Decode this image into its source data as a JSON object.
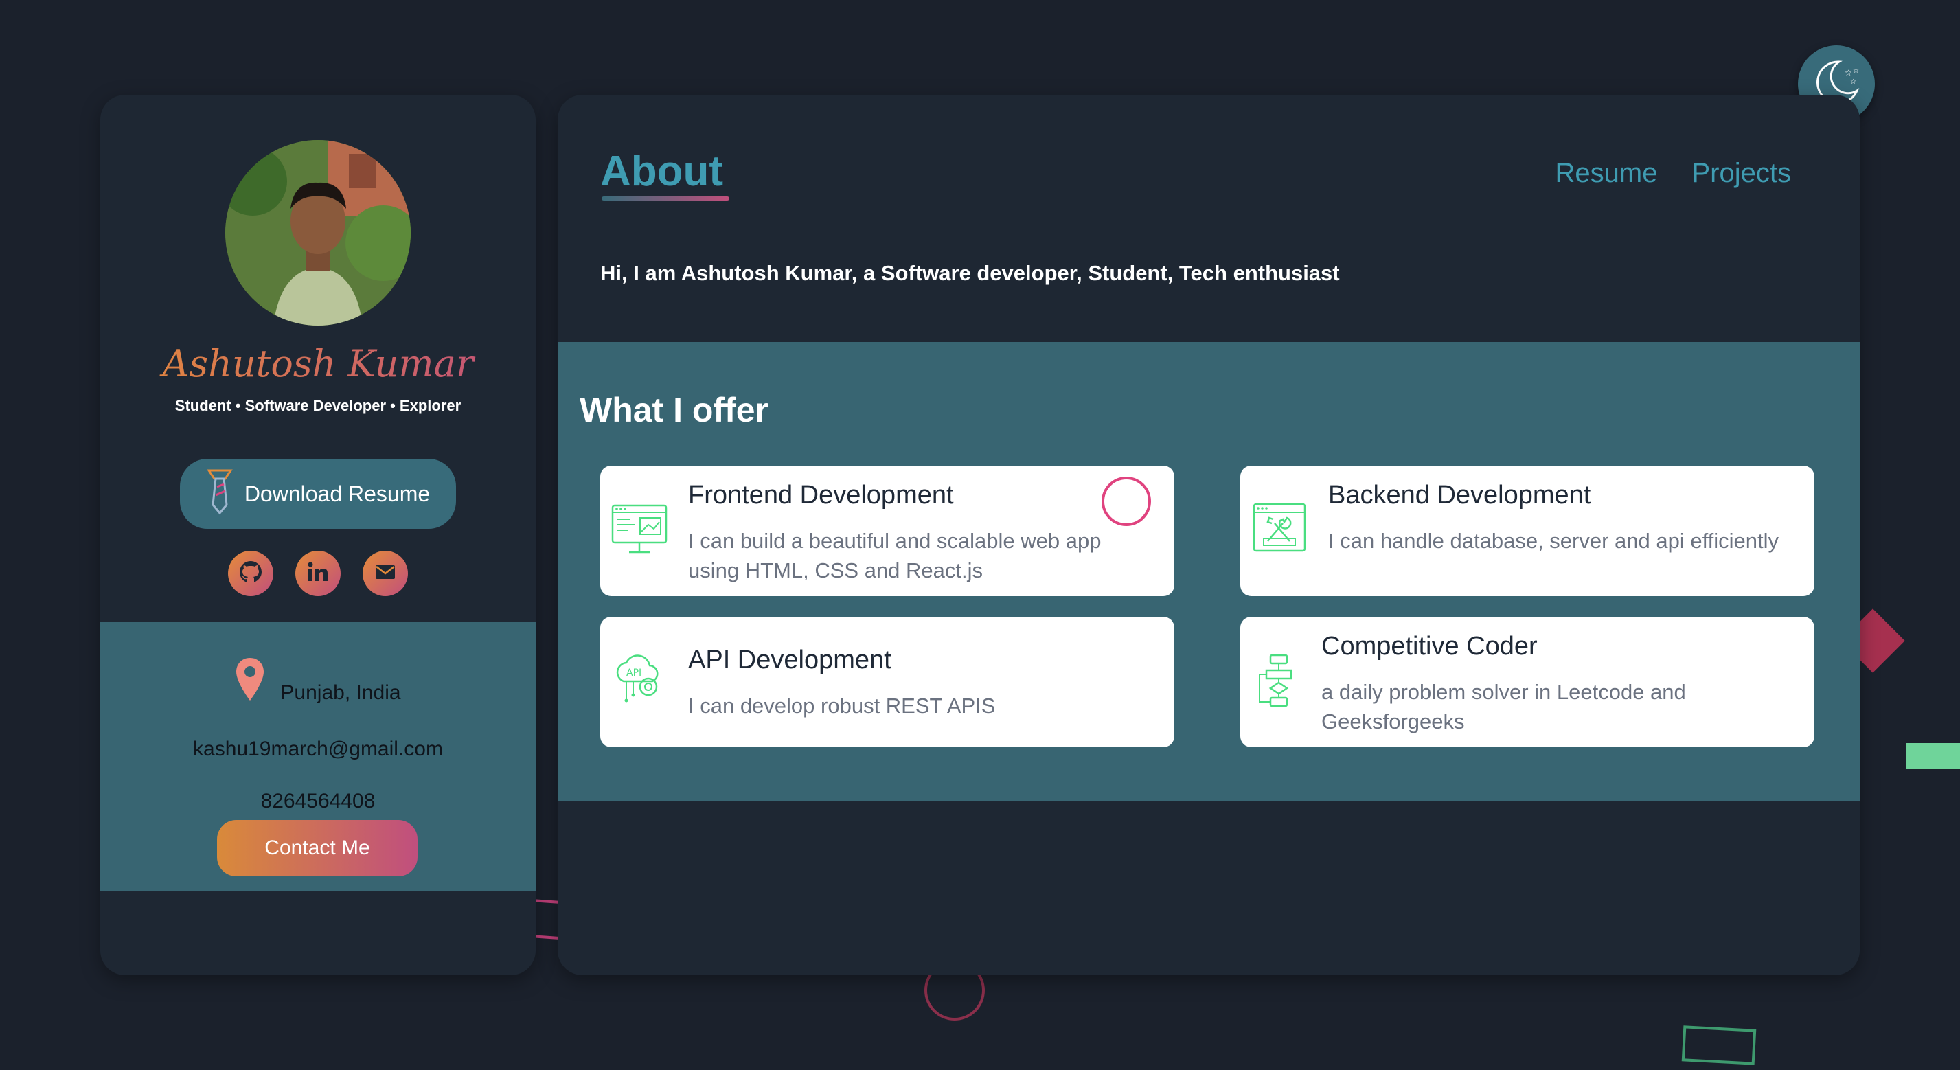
{
  "theme_toggle": {
    "icon": "moon-stars-icon"
  },
  "profile": {
    "name": "Ashutosh Kumar",
    "tagline": "Student • Software Developer • Explorer",
    "download_label": "Download Resume",
    "socials": [
      {
        "icon": "github-icon"
      },
      {
        "icon": "linkedin-icon"
      },
      {
        "icon": "mail-icon"
      }
    ],
    "location": "Punjab, India",
    "email": "kashu19march@gmail.com",
    "phone": "8264564408",
    "contact_label": "Contact Me"
  },
  "main": {
    "title": "About",
    "nav": [
      {
        "label": "Resume"
      },
      {
        "label": "Projects"
      }
    ],
    "intro": "Hi, I am Ashutosh Kumar, a Software developer, Student, Tech enthusiast",
    "offer_title": "What I offer",
    "services": [
      {
        "title": "Frontend Development",
        "description": "I can build a beautiful and scalable web app using HTML, CSS and React.js",
        "icon": "monitor-code-icon"
      },
      {
        "title": "Backend Development",
        "description": "I can handle database, server and api efficiently",
        "icon": "server-tools-icon"
      },
      {
        "title": "API Development",
        "description": "I can develop robust REST APIS",
        "icon": "api-cloud-icon"
      },
      {
        "title": "Competitive Coder",
        "description": "a daily problem solver in Leetcode and Geeksforgeeks",
        "icon": "flowchart-icon"
      }
    ]
  },
  "colors": {
    "background": "#1b212c",
    "card": "#1e2733",
    "accent_teal": "#386b7a",
    "link_teal": "#3f9cb2",
    "gradient_orange": "#e58c3a",
    "gradient_pink": "#c14f7c",
    "icon_green": "#4ade80"
  }
}
